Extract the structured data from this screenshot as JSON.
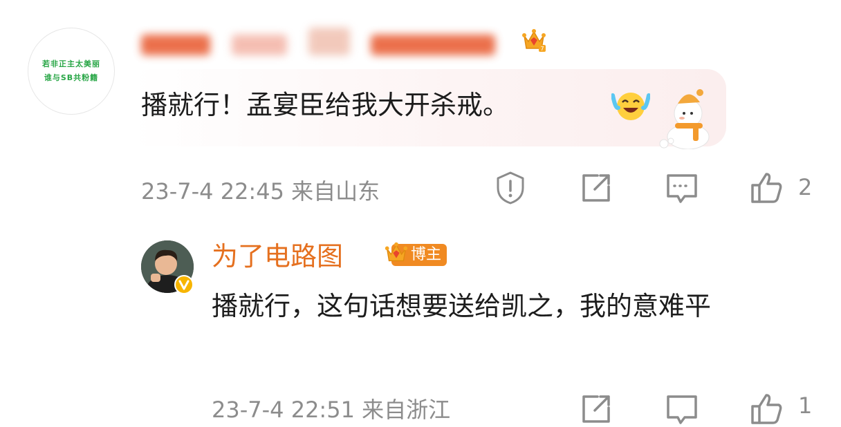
{
  "comment1": {
    "avatar_lines": [
      "若非正主太美丽",
      "谁与SB共粉籍"
    ],
    "username": "",
    "text": "播就行！孟宴臣给我大开杀戒。",
    "meta": "23-7-4 22:45 来自山东",
    "like_count": "2"
  },
  "reply": {
    "username": "为了电路图",
    "badge": "博主",
    "text": "播就行，这句话想要送给凯之，我的意难平",
    "meta": "23-7-4 22:51 来自浙江",
    "like_count": "1"
  },
  "colors": {
    "name": "#e5701f",
    "badge": "#f08a22",
    "meta": "#8c8c8c"
  }
}
